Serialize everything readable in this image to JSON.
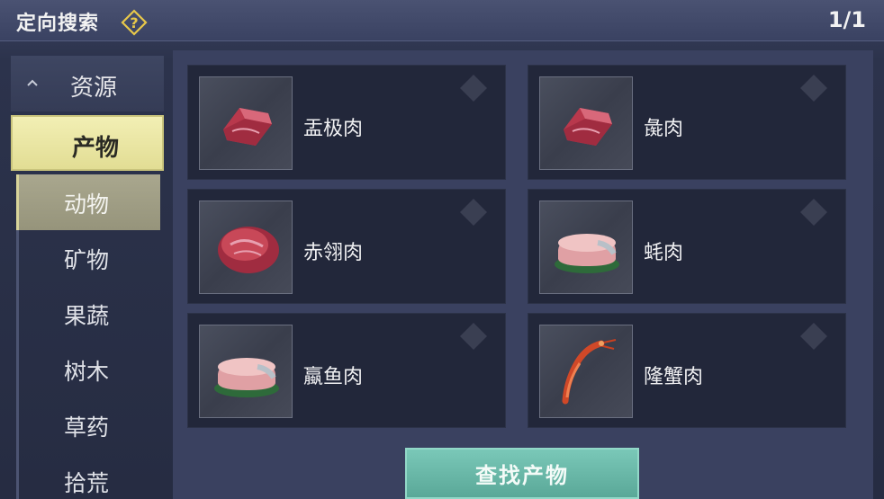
{
  "header": {
    "title": "定向搜索",
    "page_counter": "1/1",
    "accent_color": "#e8c84a"
  },
  "sidebar": {
    "category": "资源",
    "selected_sub": "产物",
    "items": [
      {
        "label": "动物",
        "active": true
      },
      {
        "label": "矿物",
        "active": false
      },
      {
        "label": "果蔬",
        "active": false
      },
      {
        "label": "树木",
        "active": false
      },
      {
        "label": "草药",
        "active": false
      },
      {
        "label": "拾荒",
        "active": false
      }
    ]
  },
  "products": [
    {
      "name": "盂极肉",
      "icon": "red-meat-chunk-icon"
    },
    {
      "name": "彘肉",
      "icon": "red-meat-chunk-icon"
    },
    {
      "name": "赤翎肉",
      "icon": "red-meat-round-icon"
    },
    {
      "name": "蚝肉",
      "icon": "fish-steak-icon"
    },
    {
      "name": "蠃鱼肉",
      "icon": "fish-steak-icon"
    },
    {
      "name": "隆蟹肉",
      "icon": "shrimp-icon"
    }
  ],
  "actions": {
    "find_label": "查找产物",
    "find_color": "#6ab8a8"
  }
}
